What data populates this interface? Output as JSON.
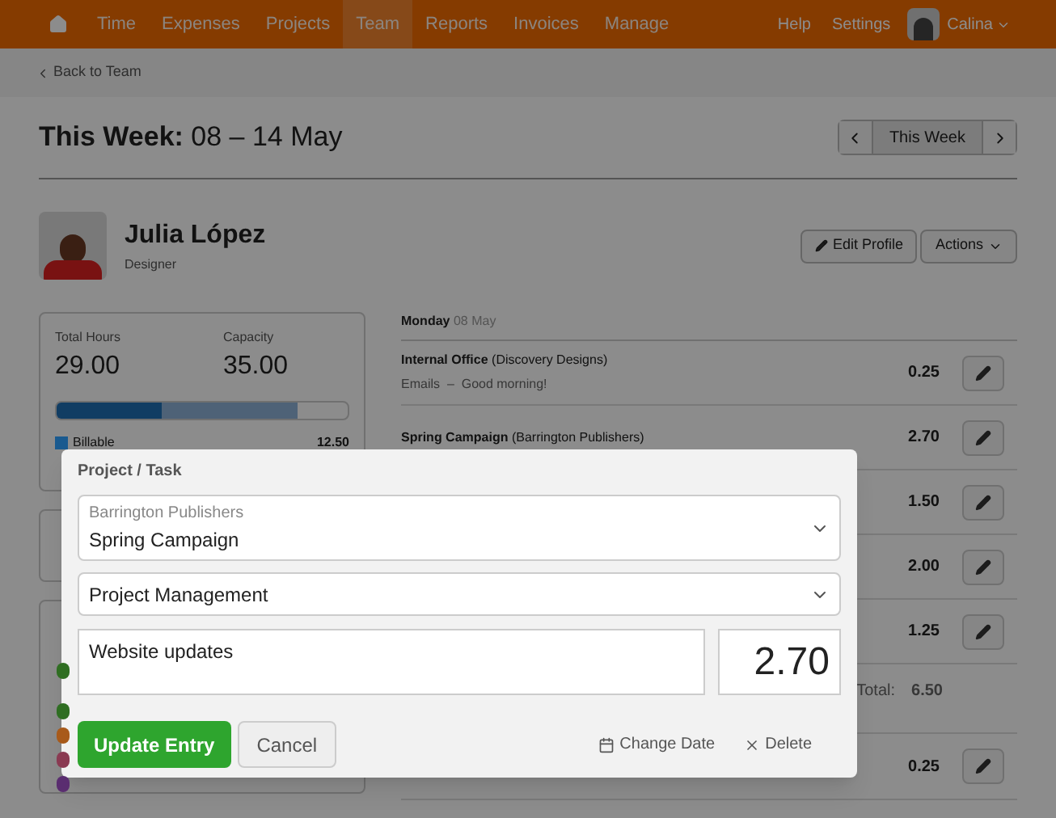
{
  "nav": {
    "items": [
      {
        "label": "Time",
        "selected": false
      },
      {
        "label": "Expenses",
        "selected": false
      },
      {
        "label": "Projects",
        "selected": false
      },
      {
        "label": "Team",
        "selected": true
      },
      {
        "label": "Reports",
        "selected": false
      },
      {
        "label": "Invoices",
        "selected": false
      },
      {
        "label": "Manage",
        "selected": false
      }
    ],
    "right": [
      "Help",
      "Settings"
    ],
    "user": "Calina"
  },
  "back_link": "Back to Team",
  "header": {
    "title": "This Week:",
    "range": "08 – 14 May",
    "week_button": "This Week"
  },
  "person": {
    "name": "Julia López",
    "role": "Designer",
    "buttons": [
      "Edit Profile",
      "Actions"
    ]
  },
  "summary": {
    "total_label": "Total Hours",
    "total": "29.00",
    "capacity_label": "Capacity",
    "capacity": "35.00",
    "bars": [
      {
        "kind": "hours",
        "level": 0.83
      },
      {
        "kind": "billable",
        "level": 0.36
      }
    ],
    "legend": [
      {
        "label": "Billable",
        "value": "12.50",
        "color": "#1a5a8f"
      }
    ]
  },
  "projects_panel": {
    "swatches": [
      {
        "color": "#2f6e22"
      },
      {
        "color": "#2f6e22"
      },
      {
        "color": "#a85a1a"
      },
      {
        "color": "#8a3a52"
      },
      {
        "color": "#5a2d70"
      }
    ]
  },
  "day": {
    "name": "Monday",
    "date": "08 May"
  },
  "entries": [
    {
      "project": "Internal Office",
      "client": "(Discovery Designs)",
      "detail": "Emails  –  Good morning!",
      "hours": "0.25"
    },
    {
      "project": "Spring Campaign",
      "client": "(Barrington Publishers)",
      "hours": "2.70"
    },
    {
      "hours": "1.50"
    },
    {
      "hours": "2.00"
    },
    {
      "hours": "1.25"
    }
  ],
  "total": {
    "label": "Total:",
    "value": "6.50"
  },
  "last_entry": {
    "hours": "0.25"
  },
  "modal": {
    "label": "Project / Task",
    "client": "Barrington Publishers",
    "project": "Spring Campaign",
    "task": "Project Management",
    "notes": "Website updates",
    "hours": "2.70",
    "primary": "Update Entry",
    "cancel": "Cancel",
    "change_date": "Change Date",
    "delete": "Delete"
  }
}
